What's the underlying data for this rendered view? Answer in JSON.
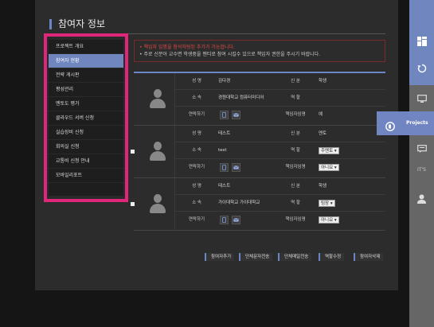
{
  "page": {
    "title": "참여자 정보"
  },
  "sidebar": {
    "items": [
      {
        "label": "프로젝트 개요",
        "active": false
      },
      {
        "label": "참여자 현황",
        "active": true
      },
      {
        "label": "전략 게시판",
        "active": false
      },
      {
        "label": "평성관리",
        "active": false
      },
      {
        "label": "멘토도 평가",
        "active": false
      },
      {
        "label": "클라우드 서버 신청",
        "active": false
      },
      {
        "label": "실습장비 신청",
        "active": false
      },
      {
        "label": "회의실 신청",
        "active": false
      },
      {
        "label": "교통비 신청 안내",
        "active": false
      },
      {
        "label": "모바일리포트",
        "active": false
      }
    ]
  },
  "notice": {
    "line1": "• 책임자 입명을 참석하팅된 추가가 가능합니다.",
    "line2": "• 주로 신분아 교수면 학생중을 멘티로 참여 시킬수 있으로 책임자 권한을 주시기 바랍니다."
  },
  "labels": {
    "name": "성 명",
    "status": "신 분",
    "affiliation": "소 속",
    "role": "역 할",
    "contact": "연락하기",
    "responsible": "책임자임명"
  },
  "members": [
    {
      "name": "김다경",
      "status": "학생",
      "affiliation": "경원대학교 컴퓨터미디어",
      "role": "",
      "role_select": "",
      "responsible": "예",
      "responsible_select": ""
    },
    {
      "name": "테스트",
      "status": "멘토",
      "affiliation": "test",
      "role": "",
      "role_select": "주멘토 ▾",
      "responsible": "",
      "responsible_select": "아니요 ▾"
    },
    {
      "name": "테스트",
      "status": "학생",
      "affiliation": "가이대학교 가이대학교",
      "role": "",
      "role_select": "팀장 ▾",
      "responsible": "",
      "responsible_select": "아니요 ▾"
    }
  ],
  "actions": [
    "참여자추가",
    "단체문자전송",
    "단체메일전송",
    "역할수정",
    "참여자삭제"
  ],
  "rail": {
    "projects_label": "Projects",
    "its_label": "IT'S"
  },
  "colors": {
    "accent": "#6f86bf",
    "highlight": "#e0267a",
    "notice_red": "#e04848"
  }
}
